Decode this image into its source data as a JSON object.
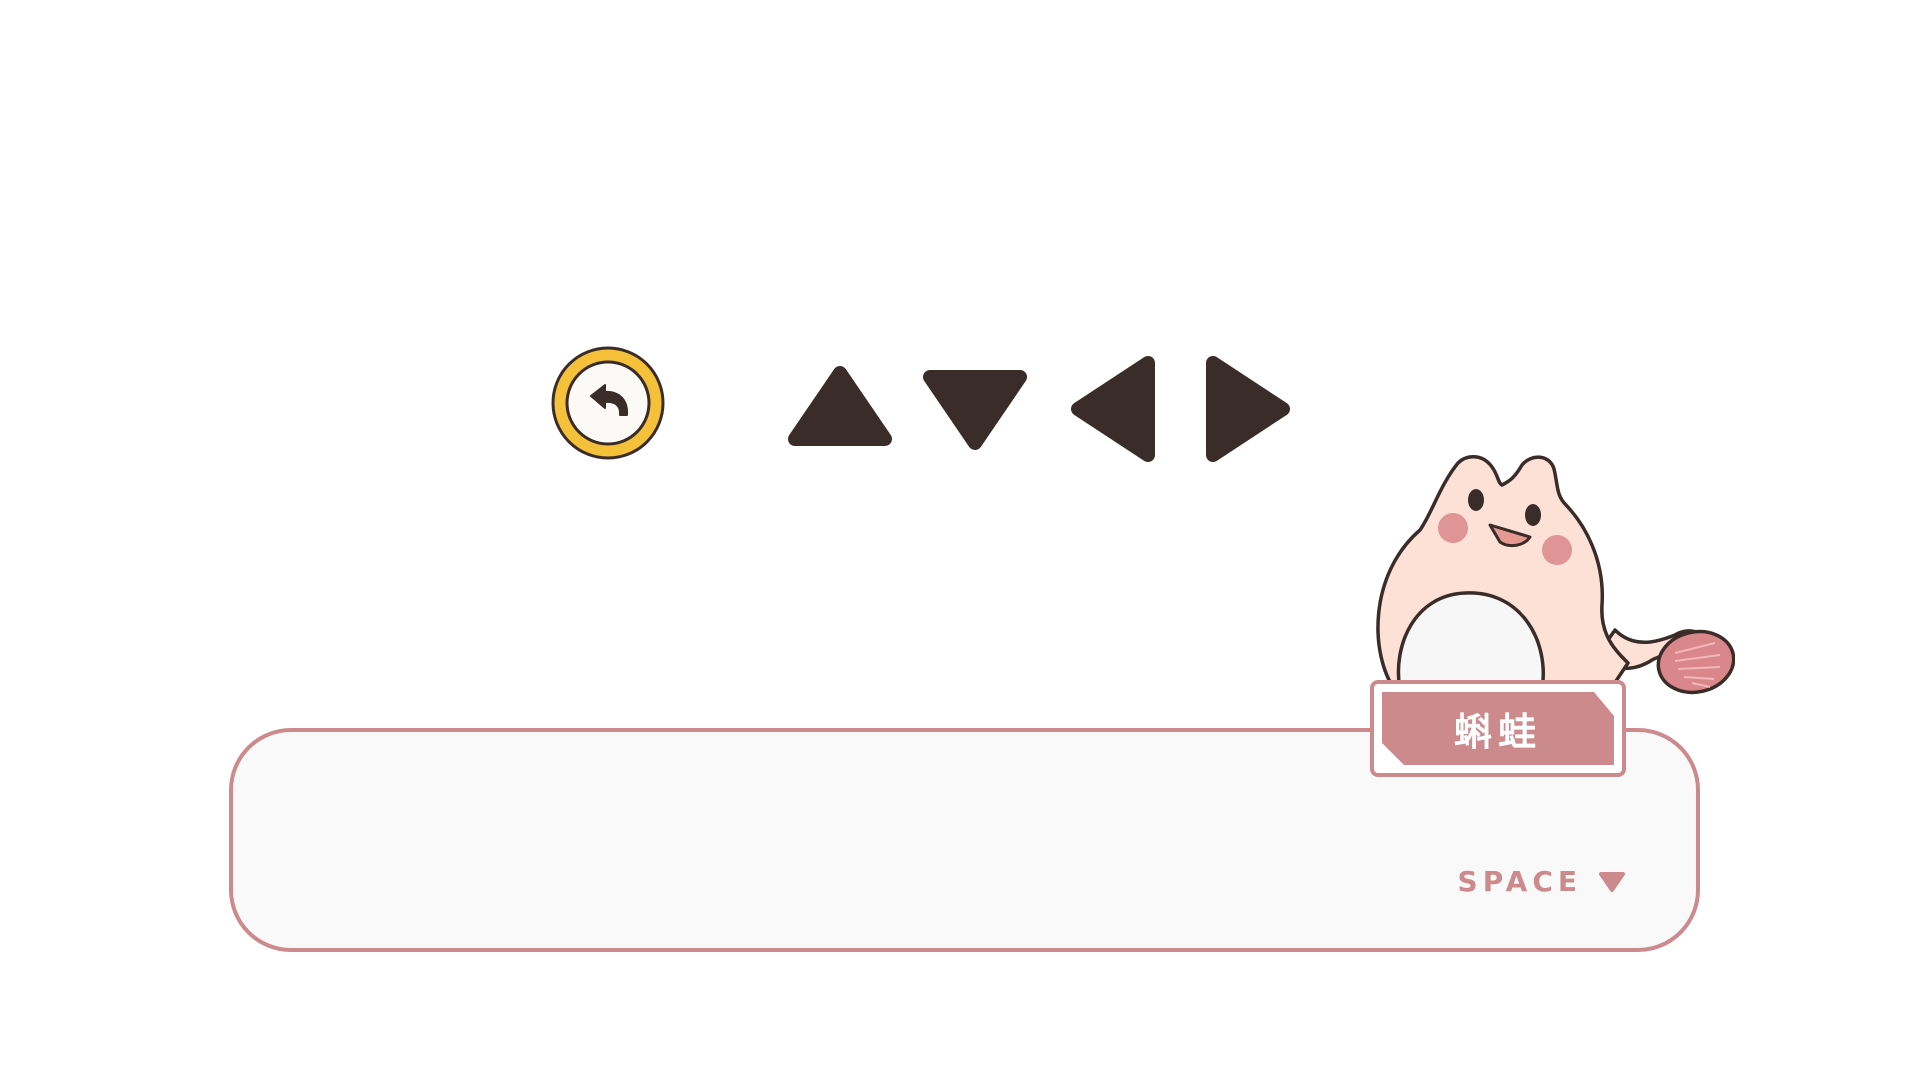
{
  "controls": {
    "back_icon": "undo-arrow-icon",
    "arrow_keys": [
      {
        "direction": "up",
        "icon": "triangle-up-icon"
      },
      {
        "direction": "down",
        "icon": "triangle-down-icon"
      },
      {
        "direction": "left",
        "icon": "triangle-left-icon"
      },
      {
        "direction": "right",
        "icon": "triangle-right-icon"
      }
    ]
  },
  "dialog": {
    "speaker_name": "蝌蛙",
    "text": "",
    "continue_hint": "SPACE",
    "continue_icon": "triangle-down-icon"
  },
  "character": {
    "sprite": "tadpole-frog-character"
  },
  "colors": {
    "accent_pink": "#cd8a8c",
    "dark_brown": "#3a2c28",
    "back_button_yellow": "#f6c13a",
    "dialog_bg": "#f9f9f9",
    "frog_skin": "#fde0d6"
  }
}
